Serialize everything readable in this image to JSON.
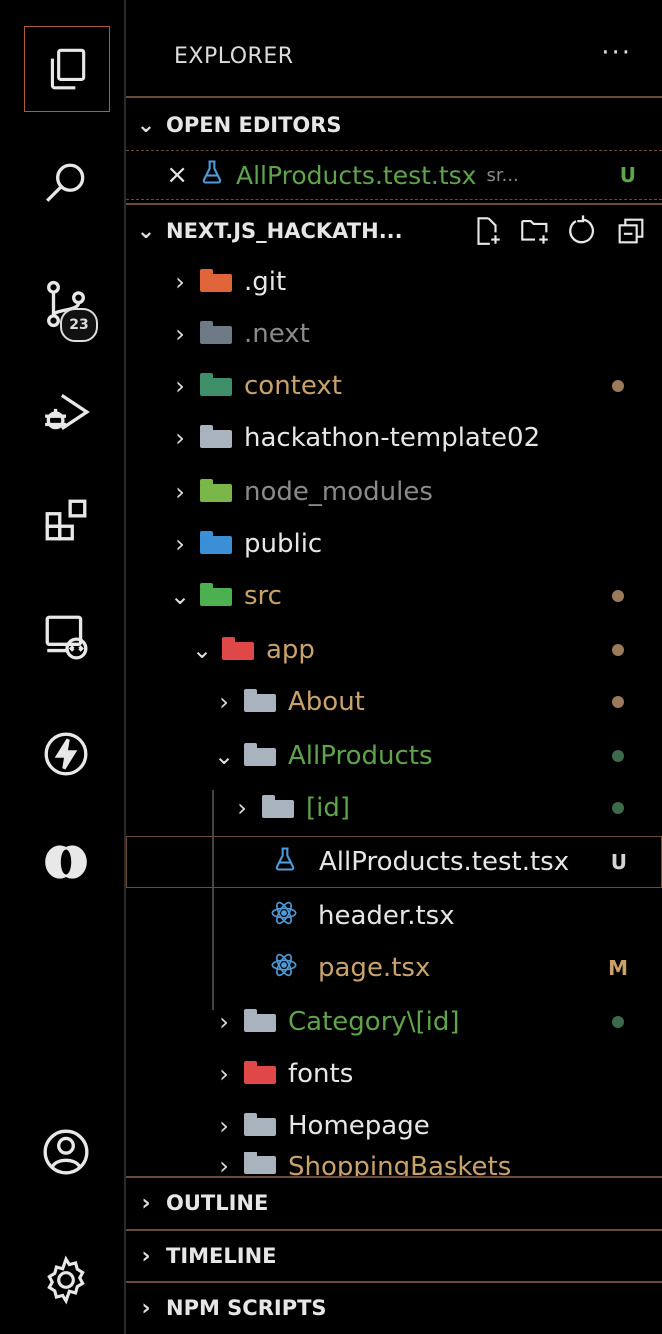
{
  "activity_bar": {
    "source_control_badge": "23"
  },
  "explorer": {
    "title": "EXPLORER",
    "more": "···",
    "open_editors": {
      "label": "OPEN EDITORS",
      "items": [
        {
          "close": "×",
          "name": "AllProducts.test.tsx",
          "path": "sr...",
          "status": "U"
        }
      ]
    },
    "project": {
      "label": "NEXT.JS_HACKATH...",
      "tree": [
        {
          "name": ".git"
        },
        {
          "name": ".next"
        },
        {
          "name": "context"
        },
        {
          "name": "hackathon-template02"
        },
        {
          "name": "node_modules"
        },
        {
          "name": "public"
        },
        {
          "name": "src"
        },
        {
          "name": "app"
        },
        {
          "name": "About"
        },
        {
          "name": "AllProducts"
        },
        {
          "name": "[id]"
        },
        {
          "name": "AllProducts.test.tsx",
          "status": "U"
        },
        {
          "name": "header.tsx"
        },
        {
          "name": "page.tsx",
          "status": "M"
        },
        {
          "name": "Category\\[id]"
        },
        {
          "name": "fonts"
        },
        {
          "name": "Homepage"
        },
        {
          "name": "ShoppingBaskets"
        }
      ]
    },
    "panels": [
      {
        "label": "OUTLINE"
      },
      {
        "label": "TIMELINE"
      },
      {
        "label": "NPM SCRIPTS"
      }
    ]
  },
  "colors": {
    "untracked": "#5fa34a",
    "modified": "#c9a26b",
    "ignored": "#8a8a8a",
    "accent_border": "#b05a3a"
  }
}
